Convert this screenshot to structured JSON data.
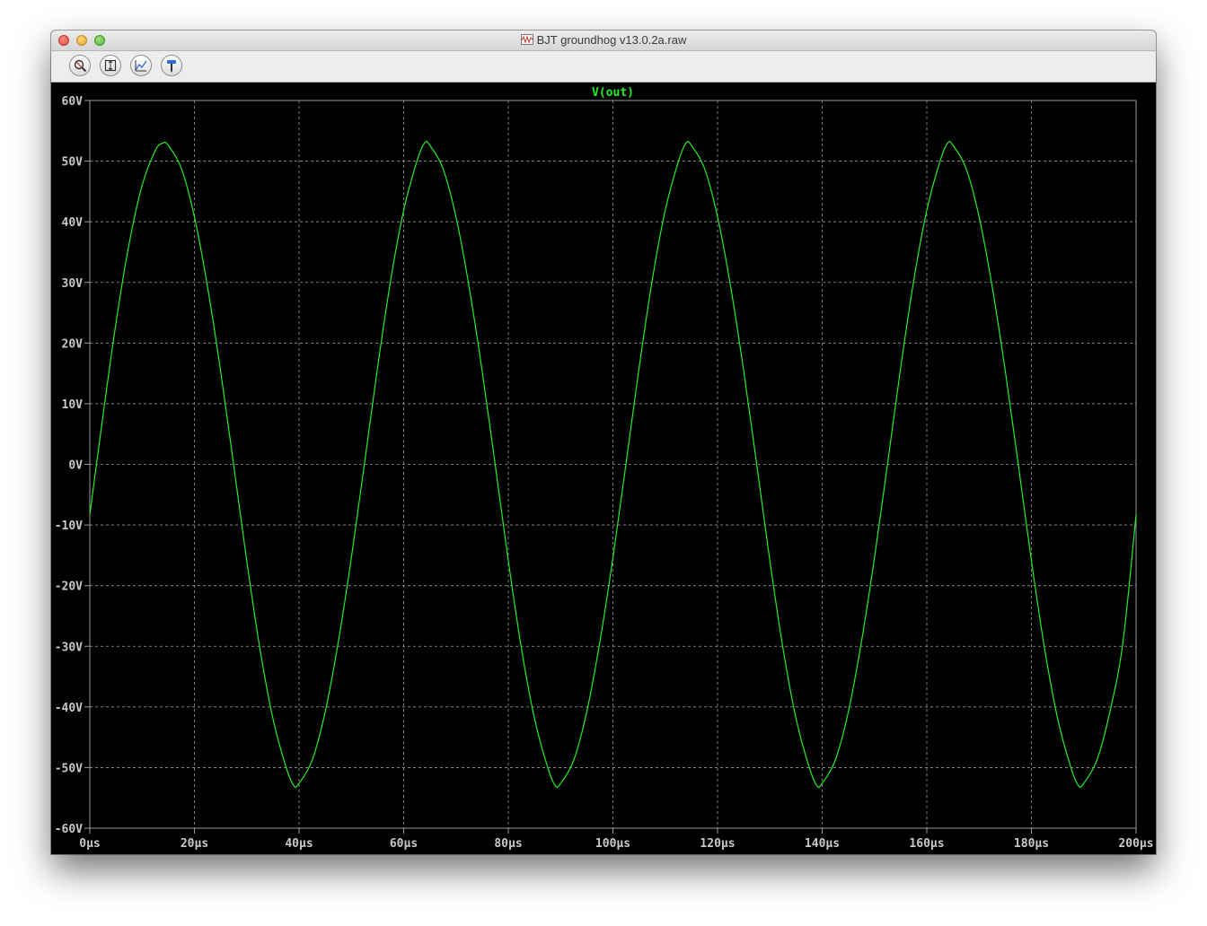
{
  "window": {
    "title": "BJT groundhog v13.0.2a.raw",
    "title_icon": "waveform-file-icon"
  },
  "toolbar": {
    "buttons": [
      {
        "name": "zoom-icon"
      },
      {
        "name": "autorange-icon"
      },
      {
        "name": "zoom-back-icon"
      },
      {
        "name": "probe-icon"
      }
    ]
  },
  "colors": {
    "background": "#000000",
    "trace": "#22ee22",
    "grid": "#9a9a9a",
    "tick_label": "#c8c8c8"
  },
  "chart_data": {
    "type": "line",
    "title": "",
    "xlabel": "",
    "ylabel": "",
    "xlim": [
      0,
      200
    ],
    "ylim": [
      -60,
      60
    ],
    "grid": true,
    "x_unit": "µs",
    "y_unit": "V",
    "x_ticks": [
      "0µs",
      "20µs",
      "40µs",
      "60µs",
      "80µs",
      "100µs",
      "120µs",
      "140µs",
      "160µs",
      "180µs",
      "200µs"
    ],
    "y_ticks": [
      "60V",
      "50V",
      "40V",
      "30V",
      "20V",
      "10V",
      "0V",
      "-10V",
      "-20V",
      "-30V",
      "-40V",
      "-50V",
      "-60V"
    ],
    "series": [
      {
        "name": "V(out)",
        "x": [
          0,
          2.5,
          5,
          7.5,
          10,
          12.5,
          14,
          15,
          17.5,
          20,
          22.5,
          25,
          27.5,
          30,
          32.5,
          35,
          37.5,
          39,
          40,
          42.5,
          45,
          47.5,
          50,
          52.5,
          55,
          57.5,
          60,
          62.5,
          64,
          65,
          67.5,
          70,
          72.5,
          75,
          77.5,
          80,
          82.5,
          85,
          87.5,
          89,
          90,
          92.5,
          95,
          97.5,
          100,
          102.5,
          105,
          107.5,
          110,
          112.5,
          114,
          115,
          117.5,
          120,
          122.5,
          125,
          127.5,
          130,
          132.5,
          135,
          137.5,
          139,
          140,
          142.5,
          145,
          147.5,
          150,
          152.5,
          155,
          157.5,
          160,
          162.5,
          164,
          165,
          167.5,
          170,
          172.5,
          175,
          177.5,
          180,
          182.5,
          185,
          187.5,
          189,
          190,
          192.5,
          195,
          197.5,
          200
        ],
        "y": [
          -8.3,
          7.9,
          23.3,
          36.3,
          46.0,
          51.7,
          53.0,
          52.6,
          48.8,
          40.8,
          29.3,
          15.4,
          -0.1,
          -15.9,
          -30.3,
          -41.9,
          -49.9,
          -53.0,
          -52.6,
          -48.8,
          -40.8,
          -29.3,
          -15.4,
          0.1,
          15.9,
          30.3,
          41.9,
          49.9,
          53.0,
          52.6,
          48.8,
          40.8,
          29.3,
          15.4,
          -0.1,
          -15.9,
          -30.3,
          -41.9,
          -49.9,
          -53.0,
          -52.6,
          -48.8,
          -40.8,
          -29.3,
          -15.4,
          0.1,
          15.9,
          30.3,
          41.9,
          49.9,
          53.0,
          52.6,
          48.8,
          40.8,
          29.3,
          15.4,
          -0.1,
          -15.9,
          -30.3,
          -41.9,
          -49.9,
          -53.0,
          -52.6,
          -48.8,
          -40.8,
          -29.3,
          -15.4,
          0.1,
          15.9,
          30.3,
          41.9,
          49.9,
          53.0,
          52.6,
          48.8,
          40.8,
          29.3,
          15.4,
          -0.1,
          -15.9,
          -30.3,
          -41.9,
          -49.9,
          -53.0,
          -52.6,
          -48.8,
          -40.8,
          -29.3,
          -8.3
        ]
      }
    ]
  }
}
